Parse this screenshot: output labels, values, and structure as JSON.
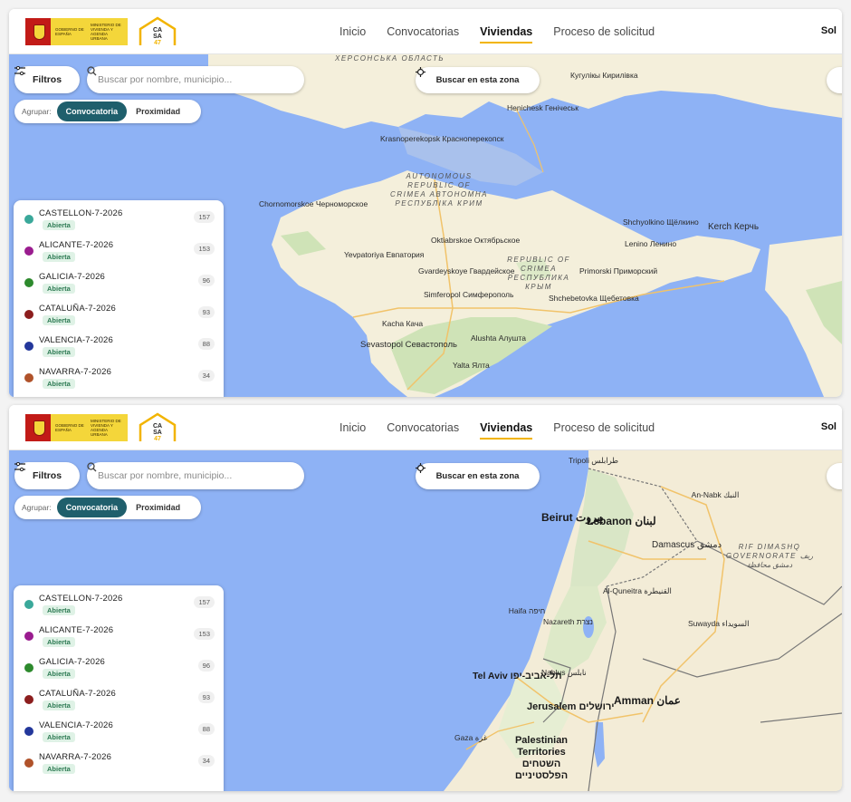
{
  "header": {
    "gov_logo_text": "GOBIERNO DE ESPAÑA",
    "gov_ministry_text": "MINISTERIO DE VIVIENDA Y AGENDA URBANA",
    "casa_logo_text": "CASA 47",
    "nav": [
      "Inicio",
      "Convocatorias",
      "Viviendas",
      "Proceso de solicitud"
    ],
    "active_nav": "Viviendas",
    "sol_label": "Sol"
  },
  "controls": {
    "filter_label": "Filtros",
    "search_placeholder": "Buscar por nombre, municipio...",
    "zone_label": "Buscar en esta zona",
    "group_label": "Agrupar:",
    "group_options": [
      "Convocatoria",
      "Proximidad"
    ],
    "group_active": "Convocatoria"
  },
  "list": [
    {
      "name": "CASTELLON-7-2026",
      "status": "Abierta",
      "count": "157",
      "color": "#3aa89a"
    },
    {
      "name": "ALICANTE-7-2026",
      "status": "Abierta",
      "count": "153",
      "color": "#9a1c8f"
    },
    {
      "name": "GALICIA-7-2026",
      "status": "Abierta",
      "count": "96",
      "color": "#2d8a2d"
    },
    {
      "name": "CATALUÑA-7-2026",
      "status": "Abierta",
      "count": "93",
      "color": "#8c1e1e"
    },
    {
      "name": "VALENCIA-7-2026",
      "status": "Abierta",
      "count": "88",
      "color": "#23379b"
    },
    {
      "name": "NAVARRA-7-2026",
      "status": "Abierta",
      "count": "34",
      "color": "#b0522a"
    }
  ],
  "map_a": {
    "labels": [
      "ХЕРСОНСЬКА ОБЛАСТЬ",
      "Кугулiкы Кирилiвка",
      "Henichesk Генiчеськ",
      "Krasnoperekopsk Красноперекопск",
      "AUTONOMOUS REPUBLIC OF CRIMEA АВТОНОМНА РЕСПУБЛIКА КРИМ",
      "Chornomorskoe Черноморское",
      "Shchyolkino Щёлкино",
      "Lenino Ленино",
      "Kerch Керчь",
      "Oktiabrskoe Октябрьское",
      "REPUBLIC OF CRIMEA РЕСПУБЛИКА КРЫМ",
      "Yevpatoriya Евпатория",
      "Gvardeyskoye Гвардейское",
      "Primorski Приморский",
      "Simferopol Симферополь",
      "Shchebetovka Щебетовка",
      "Kacha Кача",
      "Alushta Алушта",
      "Sevastopol Севастополь",
      "Yalta Ялта"
    ]
  },
  "map_b": {
    "labels": [
      "Tripoli طرابلس",
      "An-Nabk النبك",
      "Beirut بيروت",
      "Lebanon لبنان",
      "Damascus دمشق",
      "RIF DIMASHQ GOVERNORATE ريف دمشق محافظة",
      "Al-Quneitra القنيطرة",
      "Haifa חיפה",
      "Nazareth נצרת",
      "Suwayda السويداء",
      "Nablus نابلس",
      "Tel Aviv תל-אביב-יפו",
      "Amman عمان",
      "Jerusalem ירושלים",
      "Gaza غزة",
      "Palestinian Territories השטחים הפלסטיניים"
    ]
  }
}
